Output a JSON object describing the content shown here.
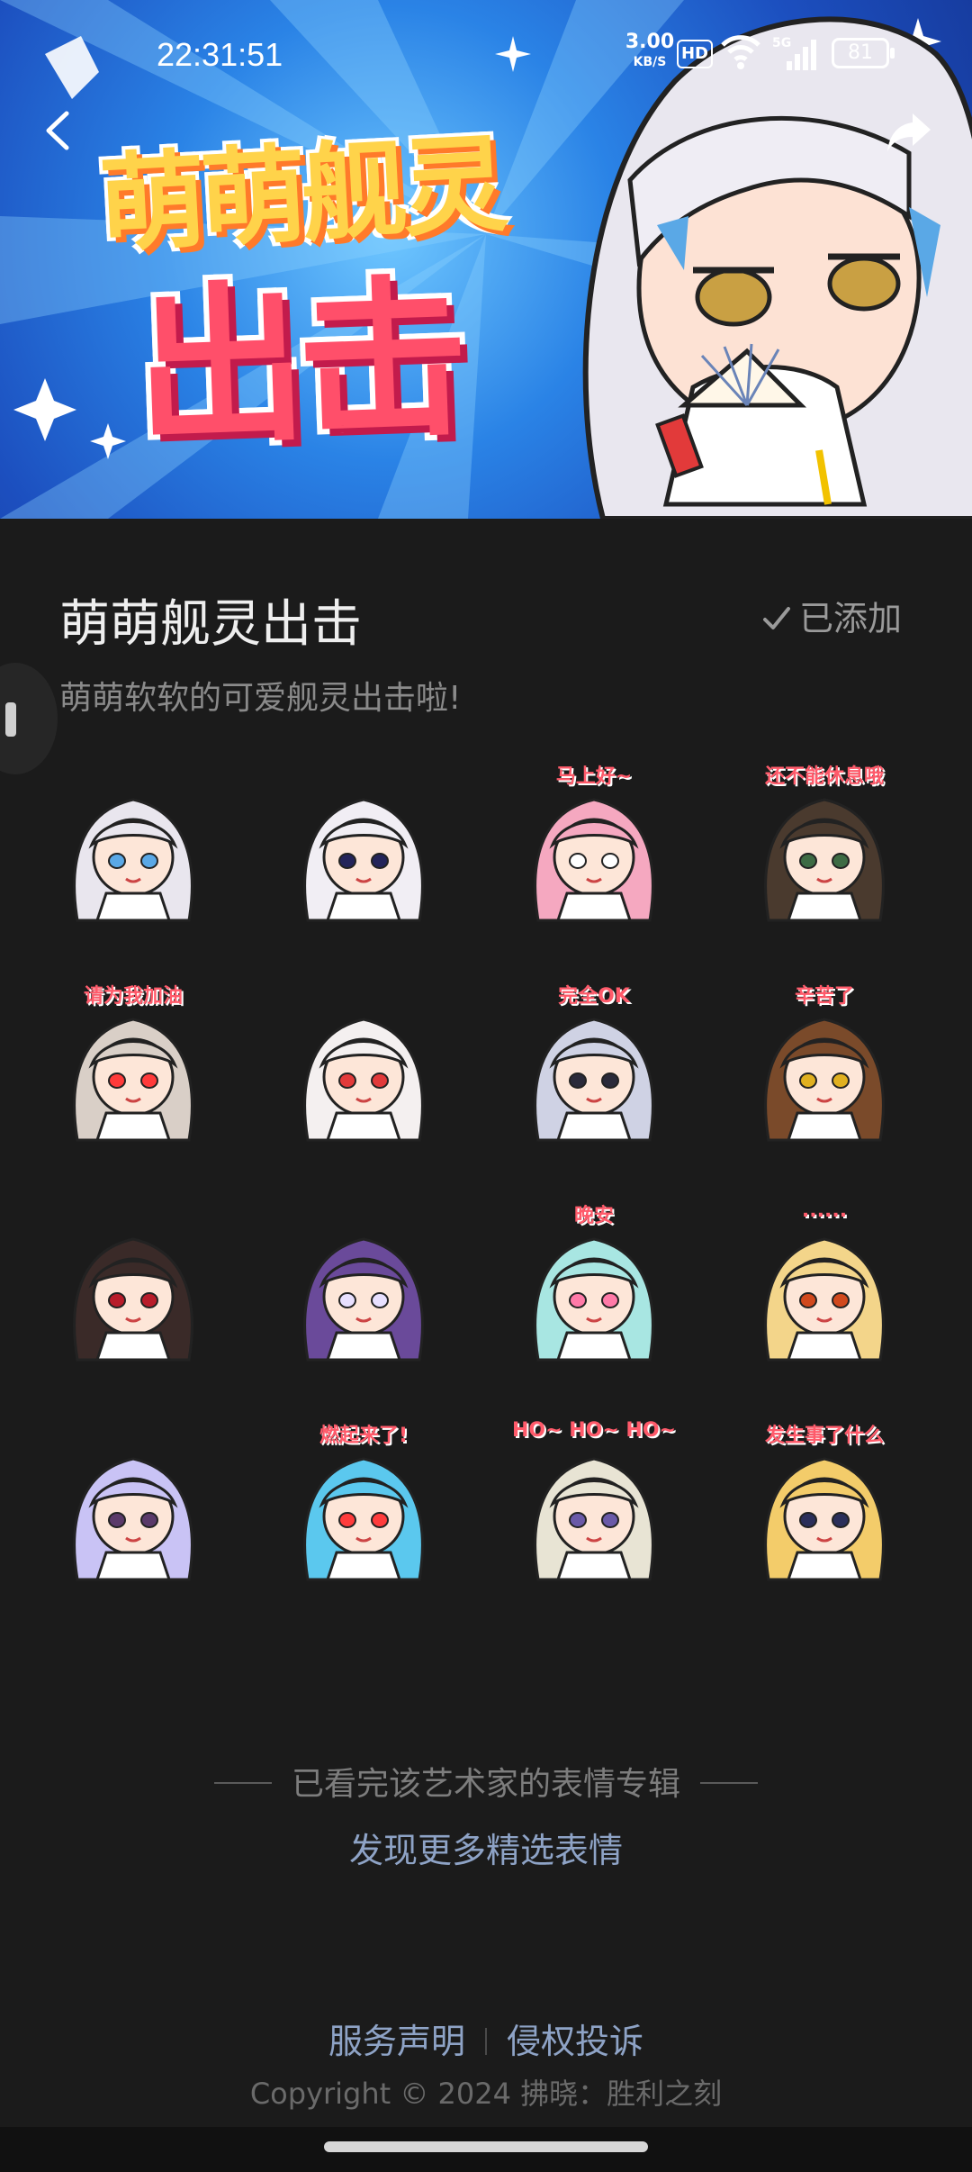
{
  "status_bar": {
    "time": "22:31:51",
    "net_speed": "3.00",
    "net_unit": "KB/S",
    "hd": "HD",
    "signal_type": "5G",
    "battery": "81"
  },
  "banner": {
    "title_line1": "萌萌舰灵",
    "title_line2": "出击",
    "colors": {
      "bg": "#2a83e6",
      "title1": "#ffd34a",
      "title2": "#ff4f6a"
    }
  },
  "pack": {
    "title": "萌萌舰灵出击",
    "status": "已添加",
    "description": "萌萌软软的可爱舰灵出击啦!"
  },
  "stickers": [
    {
      "caption": "",
      "hair": "#e9e6ee",
      "accent": "#5aa8e6"
    },
    {
      "caption": "",
      "hair": "#f1eef4",
      "accent": "#23245a"
    },
    {
      "caption": "马上好~",
      "hair": "#f5a8c0",
      "accent": "#ffffff"
    },
    {
      "caption": "还不能休息哦",
      "hair": "#4a3a2e",
      "accent": "#3d6b44"
    },
    {
      "caption": "请为我加油",
      "hair": "#d9cfc7",
      "accent": "#ff3b3b"
    },
    {
      "caption": "",
      "hair": "#f4f0f0",
      "accent": "#e23a3a"
    },
    {
      "caption": "完全OK",
      "hair": "#cfd2e4",
      "accent": "#2a2a3a"
    },
    {
      "caption": "辛苦了",
      "hair": "#7a4a2a",
      "accent": "#e0b020"
    },
    {
      "caption": "",
      "hair": "#3a2a28",
      "accent": "#b81c2a"
    },
    {
      "caption": "",
      "hair": "#6a4a9a",
      "accent": "#e8e0ff"
    },
    {
      "caption": "晚安",
      "hair": "#a8e6e2",
      "accent": "#ff7aa8"
    },
    {
      "caption": "......",
      "hair": "#f3d58a",
      "accent": "#d1491d"
    },
    {
      "caption": "",
      "hair": "#c9c3f5",
      "accent": "#5a3a6a"
    },
    {
      "caption": "燃起来了!",
      "hair": "#5bc8ee",
      "accent": "#ff3c3c"
    },
    {
      "caption": "HO~ HO~ HO~",
      "hair": "#e8e4d4",
      "accent": "#6a5aa8"
    },
    {
      "caption": "发生事了什么",
      "hair": "#f3cc6a",
      "accent": "#2b2f5a"
    }
  ],
  "footer": {
    "end_text": "已看完该艺术家的表情专辑",
    "discover": "发现更多精选表情",
    "service": "服务声明",
    "complaint": "侵权投诉",
    "copyright": "Copyright © 2024 拂晓：胜利之刻"
  },
  "icons": {
    "back": "back-arrow-icon",
    "share": "share-icon",
    "check": "check-icon"
  }
}
